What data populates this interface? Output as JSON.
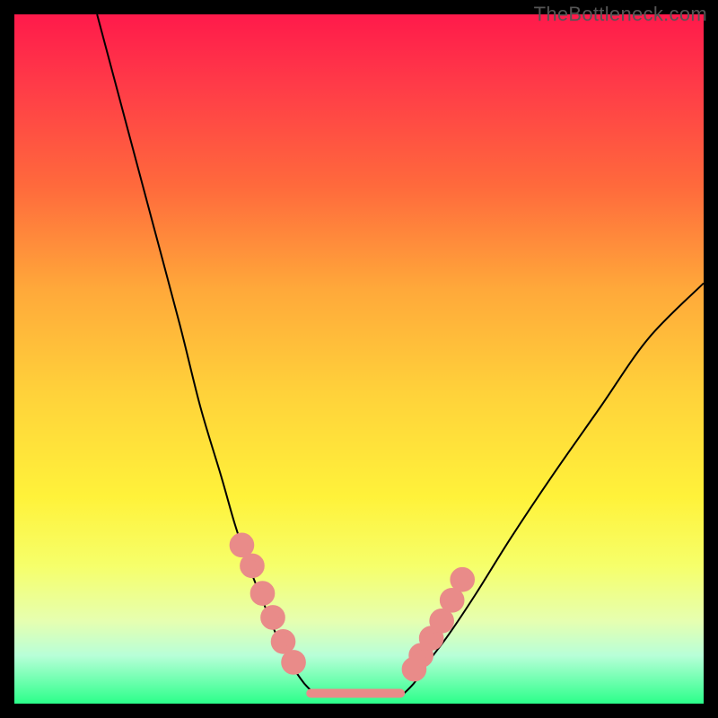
{
  "watermark": "TheBottleneck.com",
  "colors": {
    "background_frame": "#000000",
    "gradient_top": "#ff1a4b",
    "gradient_bottom": "#2bff8a",
    "curve": "#000000",
    "markers": "#e98b89"
  },
  "chart_data": {
    "type": "line",
    "title": "",
    "xlabel": "",
    "ylabel": "",
    "xlim": [
      0,
      100
    ],
    "ylim": [
      0,
      100
    ],
    "grid": false,
    "legend": false,
    "annotations": [],
    "series": [
      {
        "name": "left-curve",
        "x": [
          12,
          16,
          20,
          24,
          27,
          30,
          32,
          34,
          36,
          38,
          40,
          42,
          44
        ],
        "y": [
          100,
          85,
          70,
          55,
          43,
          33,
          26,
          20,
          15,
          10,
          6,
          3,
          1
        ]
      },
      {
        "name": "plateau",
        "x": [
          44,
          48,
          52,
          56
        ],
        "y": [
          1,
          1,
          1,
          1
        ]
      },
      {
        "name": "right-curve",
        "x": [
          56,
          58,
          60,
          63,
          67,
          72,
          78,
          85,
          92,
          100
        ],
        "y": [
          1,
          3,
          6,
          10,
          16,
          24,
          33,
          43,
          53,
          61
        ]
      }
    ],
    "markers_left": {
      "name": "dots-left-branch",
      "x": [
        33,
        34.5,
        36,
        37.5,
        39,
        40.5
      ],
      "y": [
        23,
        20,
        16,
        12.5,
        9,
        6
      ]
    },
    "markers_right": {
      "name": "dots-right-branch",
      "x": [
        58,
        59,
        60.5,
        62,
        63.5,
        65
      ],
      "y": [
        5,
        7,
        9.5,
        12,
        15,
        18
      ]
    },
    "plateau_band": {
      "x_start": 43,
      "x_end": 56,
      "y": 1.5
    }
  }
}
